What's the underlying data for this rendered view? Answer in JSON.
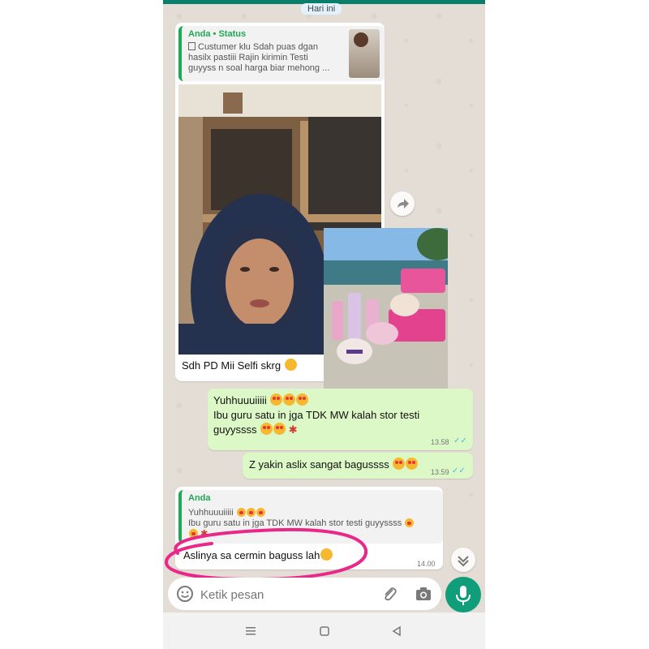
{
  "date_label": "Hari ini",
  "status_reply": {
    "author": "Anda • Status",
    "text": "Custumer klu Sdah puas dgan hasilx pastiii Rajin kirimin Testi guyyss n soal harga  biar mehong ..."
  },
  "msg1": {
    "text": "Sdh PD Mii Selfi skrg"
  },
  "msg2": {
    "line1": "Yuhhuuuiiiii",
    "line2": "Ibu guru satu in jga TDK MW kalah stor testi",
    "line3": "guyyssss",
    "time": "13.58"
  },
  "msg3": {
    "text": "Z yakin aslix sangat bagussss",
    "time": "13.59"
  },
  "msg4": {
    "quote_author": "Anda",
    "quote_line1": "Yuhhuuuiiiii",
    "quote_line2": "Ibu guru satu in jga TDK MW kalah stor testi guyyssss",
    "text": "Aslinya sa cermin baguss lah",
    "time": "14.00"
  },
  "input": {
    "placeholder": "Ketik pesan"
  },
  "icons": {
    "emoji": "emoji-icon",
    "attach": "paperclip-icon",
    "camera": "camera-icon",
    "mic": "microphone-icon",
    "forward": "forward-icon",
    "scroll": "chevron-down-icon"
  },
  "colors": {
    "accent": "#0f9d7a",
    "outgoing": "#dcf8c6",
    "quote_bar": "#1fa855",
    "highlight": "#e8298a"
  }
}
